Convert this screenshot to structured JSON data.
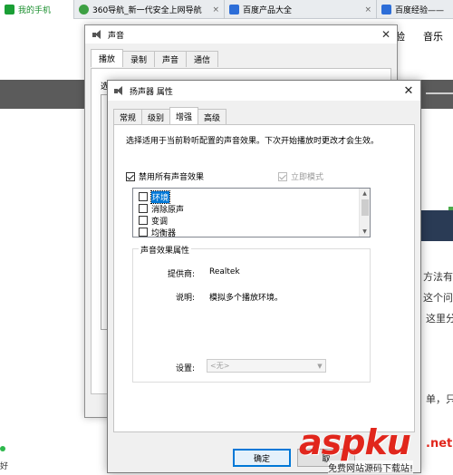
{
  "browser_tabs": [
    {
      "label": "我的手机",
      "icon": "phone-icon"
    },
    {
      "label": "360导航_新一代安全上网导航",
      "icon": "360-icon"
    },
    {
      "label": "百度产品大全",
      "icon": "baidu-paw-icon"
    },
    {
      "label": "百度经验——",
      "icon": "baidu-paw-icon"
    }
  ],
  "tab_close": "×",
  "background_page": {
    "nav": [
      "经验",
      "音乐"
    ],
    "side_texts": [
      "方法有",
      "这个问",
      "这里分",
      "单，只"
    ],
    "bottom_left": "好"
  },
  "sound_dialog": {
    "title": "声音",
    "close": "✕",
    "tabs": [
      "播放",
      "录制",
      "声音",
      "通信"
    ],
    "fragment": "选"
  },
  "props_dialog": {
    "title": "扬声器 属性",
    "close": "✕",
    "tabs": [
      "常规",
      "级别",
      "增强",
      "高级"
    ],
    "active_tab": "增强",
    "description": "选择适用于当前聆听配置的声音效果。下次开始播放时更改才会生效。",
    "disable_all": {
      "label": "禁用所有声音效果",
      "checked": true
    },
    "immediate_mode": {
      "label": "立即模式",
      "checked": true,
      "disabled": true
    },
    "effects": [
      {
        "label": "环境",
        "checked": false,
        "selected": true
      },
      {
        "label": "消除原声",
        "checked": false,
        "selected": false
      },
      {
        "label": "变调",
        "checked": false,
        "selected": false
      },
      {
        "label": "均衡器",
        "checked": false,
        "selected": false
      }
    ],
    "properties": {
      "legend": "声音效果属性",
      "provider_label": "提供商:",
      "provider_value": "Realtek",
      "description_label": "说明:",
      "description_value": "模拟多个播放环境。",
      "settings_label": "设置:",
      "settings_value": "<无>"
    },
    "ok_label": "确定",
    "cancel_label": "取"
  },
  "watermark": {
    "logo": "aspku",
    "net": ".net",
    "slogan": "免费网站源码下载站!"
  },
  "colors": {
    "accent": "#0078d7",
    "watermark": "#e1261c",
    "tab_green": "#1a8f2e"
  }
}
